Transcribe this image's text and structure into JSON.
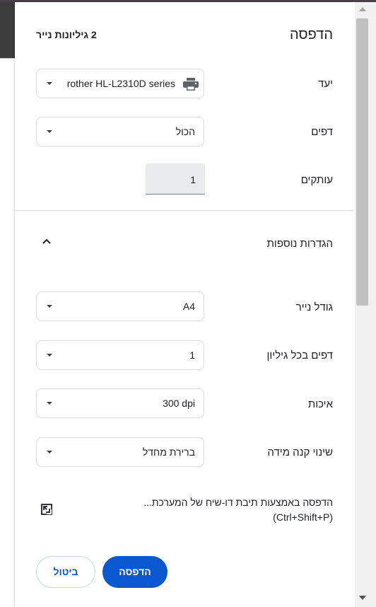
{
  "header": {
    "title": "הדפסה",
    "sheet_count": "2 גיליונות נייר"
  },
  "destination": {
    "label": "יעד",
    "value": "rother HL-L2310D series",
    "icon": "printer-icon"
  },
  "pages": {
    "label": "דפים",
    "value": "הכול"
  },
  "copies": {
    "label": "עותקים",
    "value": "1"
  },
  "more_settings": {
    "label": "הגדרות נוספות",
    "icon": "chevron-up-icon"
  },
  "paper_size": {
    "label": "גודל נייר",
    "value": "A4"
  },
  "pages_per_sheet": {
    "label": "דפים בכל גיליון",
    "value": "1"
  },
  "quality": {
    "label": "איכות",
    "value": "300 dpi"
  },
  "scale": {
    "label": "שינוי קנה מידה",
    "value": "ברירת מחדל"
  },
  "system_dialog": {
    "line1": "הדפסה באמצעות תיבת דו-שיח של המערכת...",
    "line2": "(Ctrl+Shift+P)",
    "icon": "open-external-icon"
  },
  "buttons": {
    "cancel": "ביטול",
    "print": "הדפסה"
  },
  "colors": {
    "accent": "#0b57d0",
    "border": "#dadce0",
    "copies_bg": "#e8eaed"
  }
}
